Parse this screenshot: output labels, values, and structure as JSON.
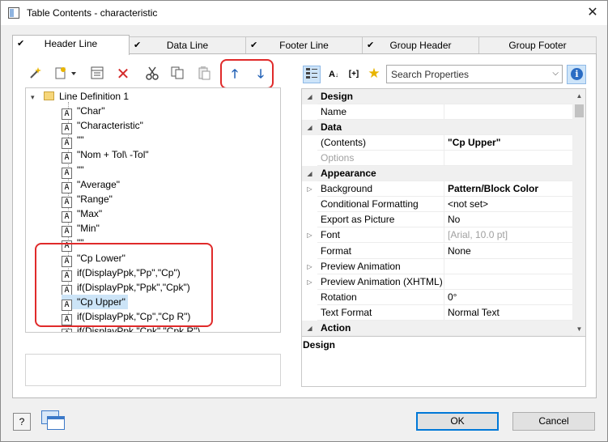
{
  "window": {
    "title": "Table Contents - characteristic"
  },
  "tabs": [
    {
      "label": "Header Line",
      "active": true
    },
    {
      "label": "Data Line",
      "active": false
    },
    {
      "label": "Footer Line",
      "active": false
    },
    {
      "label": "Group Header",
      "active": false
    },
    {
      "label": "Group Footer",
      "active": false
    }
  ],
  "left_toolbar": {
    "icons": [
      "wizard-icon",
      "new-item-icon",
      "properties-icon",
      "delete-icon",
      "cut-icon",
      "copy-icon",
      "paste-icon",
      "move-up-icon",
      "move-down-icon"
    ]
  },
  "tree": {
    "root": {
      "label": "Line Definition  1"
    },
    "items": [
      "\"Char\"",
      "\"Characteristic\"",
      "\"\"",
      "\"Nom + Tol\\ -Tol\"",
      "\"\"",
      "\"Average\"",
      "\"Range\"",
      "\"Max\"",
      "\"Min\"",
      "\"\"",
      "\"Cp Lower\"",
      "if(DisplayPpk,\"Pp\",\"Cp\")",
      "if(DisplayPpk,\"Ppk\",\"Cpk\")",
      "\"Cp Upper\"",
      "if(DisplayPpk,\"Cp\",\"Cp R\")",
      "if(DisplayPpk,\"Cpk\",\"Cpk R\")"
    ],
    "selected_index": 13,
    "item_icon_glyph": "A"
  },
  "properties": {
    "search_placeholder": "Search Properties",
    "rows": [
      {
        "kind": "category",
        "name": "Design"
      },
      {
        "kind": "prop",
        "name": "Name",
        "value": ""
      },
      {
        "kind": "category",
        "name": "Data"
      },
      {
        "kind": "prop",
        "name": "(Contents)",
        "value": "\"Cp Upper\"",
        "value_bold": true
      },
      {
        "kind": "prop",
        "name": "Options",
        "value": "",
        "muted": true
      },
      {
        "kind": "category",
        "name": "Appearance"
      },
      {
        "kind": "prop",
        "name": "Background",
        "value": "Pattern/Block Color",
        "value_bold": true,
        "expandable": true
      },
      {
        "kind": "prop",
        "name": "Conditional Formatting",
        "value": "<not set>"
      },
      {
        "kind": "prop",
        "name": "Export as Picture",
        "value": "No"
      },
      {
        "kind": "prop",
        "name": "Font",
        "value": "[Arial, 10.0 pt]",
        "value_muted": true,
        "expandable": true
      },
      {
        "kind": "prop",
        "name": "Format",
        "value": "None"
      },
      {
        "kind": "prop",
        "name": "Preview Animation",
        "value": "",
        "expandable": true
      },
      {
        "kind": "prop",
        "name": "Preview Animation (XHTML)",
        "value": "",
        "expandable": true
      },
      {
        "kind": "prop",
        "name": "Rotation",
        "value": "0°"
      },
      {
        "kind": "prop",
        "name": "Text Format",
        "value": "Normal Text"
      },
      {
        "kind": "category",
        "name": "Action"
      }
    ],
    "description_title": "Design"
  },
  "buttons": {
    "ok": "OK",
    "cancel": "Cancel",
    "help": "?"
  },
  "colors": {
    "selection": "#cce4f7",
    "annotation_red": "#e02a2a",
    "accent": "#0078d7"
  }
}
